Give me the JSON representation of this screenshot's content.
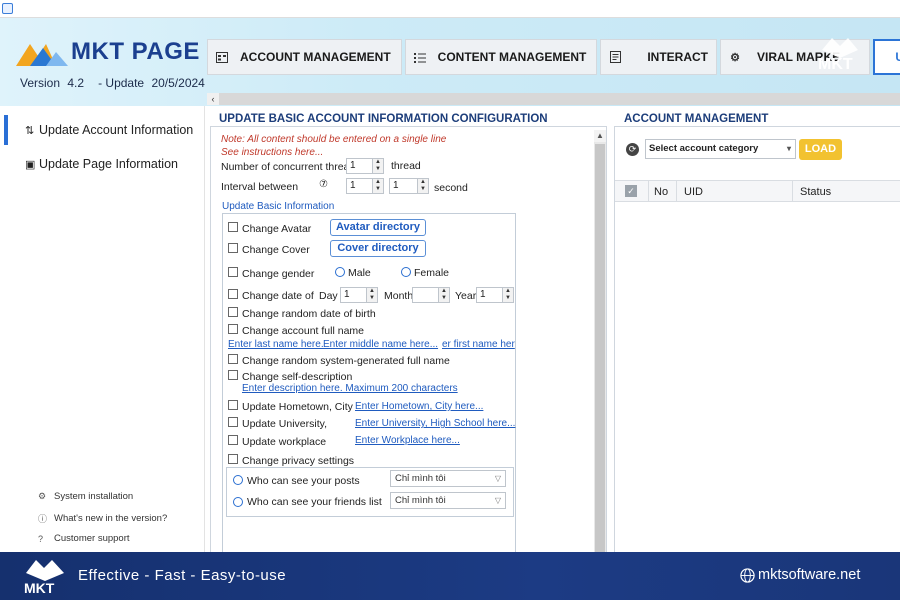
{
  "header": {
    "logo_text": "MKT PAGE",
    "version_label": "Version",
    "version_number": "4.2",
    "update_label": "- Update",
    "update_date": "20/5/2024",
    "watermark_text": "MKT"
  },
  "tabs": [
    {
      "label": "ACCOUNT MANAGEMENT",
      "icon": "grid-icon"
    },
    {
      "label": "CONTENT MANAGEMENT",
      "icon": "list-icon"
    },
    {
      "label": "INTERACT",
      "icon": "document-icon"
    },
    {
      "label": "VIRAL MARKE",
      "icon": "gear-group-icon"
    }
  ],
  "tab_selected_partial": "UP",
  "sidebar": {
    "items": [
      {
        "label": "Update Account Information",
        "icon": "sort-arrows-icon",
        "active": true
      },
      {
        "label": "Update Page Information",
        "icon": "page-icon",
        "active": false
      }
    ],
    "footer": [
      {
        "label": "System installation",
        "icon": "gear-icon"
      },
      {
        "label": "What's new in the version?",
        "icon": "info-icon"
      },
      {
        "label": "Customer support",
        "icon": "help-icon"
      }
    ]
  },
  "left_panel": {
    "title": "UPDATE BASIC ACCOUNT INFORMATION CONFIGURATION",
    "note": "Note: All content should be entered on a single line",
    "instructions": "See instructions here...",
    "concurrent_label": "Number of concurrent threads",
    "concurrent_value": "1",
    "thread_unit": "thread",
    "interval_label": "Interval between",
    "interval_from": "1",
    "interval_to": "1",
    "second_unit": "second",
    "group_title": "Update Basic Information",
    "change_avatar": "Change Avatar",
    "avatar_dir": "Avatar directory",
    "change_cover": "Change Cover",
    "cover_dir": "Cover directory",
    "change_gender": "Change gender",
    "male": "Male",
    "female": "Female",
    "change_dob": "Change date of bi",
    "day_label": "Day",
    "day_value": "1",
    "month_label": "Month",
    "month_value": "",
    "year_label": "Year",
    "year_value": "1",
    "random_dob": "Change random date of birth",
    "change_fullname": "Change account full name",
    "last_name_ph": "Enter last name here.",
    "middle_name_ph": "Enter middle name here...",
    "first_name_ph": "er first name her",
    "random_fullname": "Change random system-generated full name",
    "change_desc": "Change self-description",
    "desc_ph": "Enter description here. Maximum 200 characters",
    "hometown": "Update Hometown, City",
    "hometown_ph": "Enter Hometown, City here...",
    "university": "Update University,",
    "university_ph": "Enter University, High School here...",
    "workplace": "Update workplace",
    "workplace_ph": "Enter Workplace here...",
    "privacy": "Change privacy settings",
    "posts_label": "Who can see your posts",
    "posts_value": "Chỉ mình tôi",
    "friends_label": "Who can see your friends list",
    "friends_value": "Chỉ mình tôi"
  },
  "right_panel": {
    "title": "ACCOUNT MANAGEMENT",
    "category_placeholder": "Select account category",
    "load_button": "LOAD",
    "columns": [
      "No",
      "UID",
      "Status"
    ]
  },
  "footer": {
    "slogan": "Effective - Fast - Easy-to-use",
    "website": "mktsoftware.net"
  },
  "colors": {
    "brand_blue": "#1b3f8f",
    "accent_yellow": "#f2c230",
    "link_blue": "#1f5bbf",
    "footer_navy": "#15306e"
  }
}
